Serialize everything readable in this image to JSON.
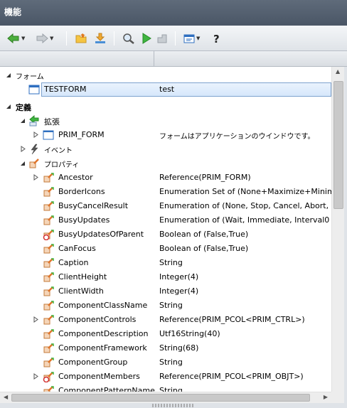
{
  "window": {
    "title": "機能"
  },
  "toolbar": {
    "icons": [
      "back-arrow-icon",
      "forward-arrow-icon",
      "open-folder-icon",
      "download-icon",
      "find-icon",
      "run-icon",
      "step-icon",
      "view-icon",
      "help-icon"
    ]
  },
  "tree": {
    "sections": {
      "form": "フォーム",
      "definition": "定義",
      "extension": "拡張",
      "events": "イベント",
      "properties": "プロパティ"
    },
    "form_row": {
      "name": "TESTFORM",
      "desc": "test"
    },
    "extension_row": {
      "name": "PRIM_FORM",
      "desc": "フォームはアプリケーションのウインドウです。"
    },
    "properties": [
      {
        "name": "Ancestor",
        "desc": "Reference(PRIM_FORM)"
      },
      {
        "name": "BorderIcons",
        "desc": "Enumeration Set of (None+Maximize+Minim"
      },
      {
        "name": "BusyCancelResult",
        "desc": "Enumeration of (None, Stop, Cancel, Abort,"
      },
      {
        "name": "BusyUpdates",
        "desc": "Enumeration of (Wait, Immediate, Interval0"
      },
      {
        "name": "BusyUpdatesOfParent",
        "desc": "Boolean of (False,True)"
      },
      {
        "name": "CanFocus",
        "desc": "Boolean of (False,True)"
      },
      {
        "name": "Caption",
        "desc": "String"
      },
      {
        "name": "ClientHeight",
        "desc": "Integer(4)"
      },
      {
        "name": "ClientWidth",
        "desc": "Integer(4)"
      },
      {
        "name": "ComponentClassName",
        "desc": "String"
      },
      {
        "name": "ComponentControls",
        "desc": "Reference(PRIM_PCOL<PRIM_CTRL>)"
      },
      {
        "name": "ComponentDescription",
        "desc": "Utf16String(40)"
      },
      {
        "name": "ComponentFramework",
        "desc": "String(68)"
      },
      {
        "name": "ComponentGroup",
        "desc": "String"
      },
      {
        "name": "ComponentMembers",
        "desc": "Reference(PRIM_PCOL<PRIM_OBJT>)"
      },
      {
        "name": "ComponentPatternName",
        "desc": "String"
      }
    ]
  }
}
